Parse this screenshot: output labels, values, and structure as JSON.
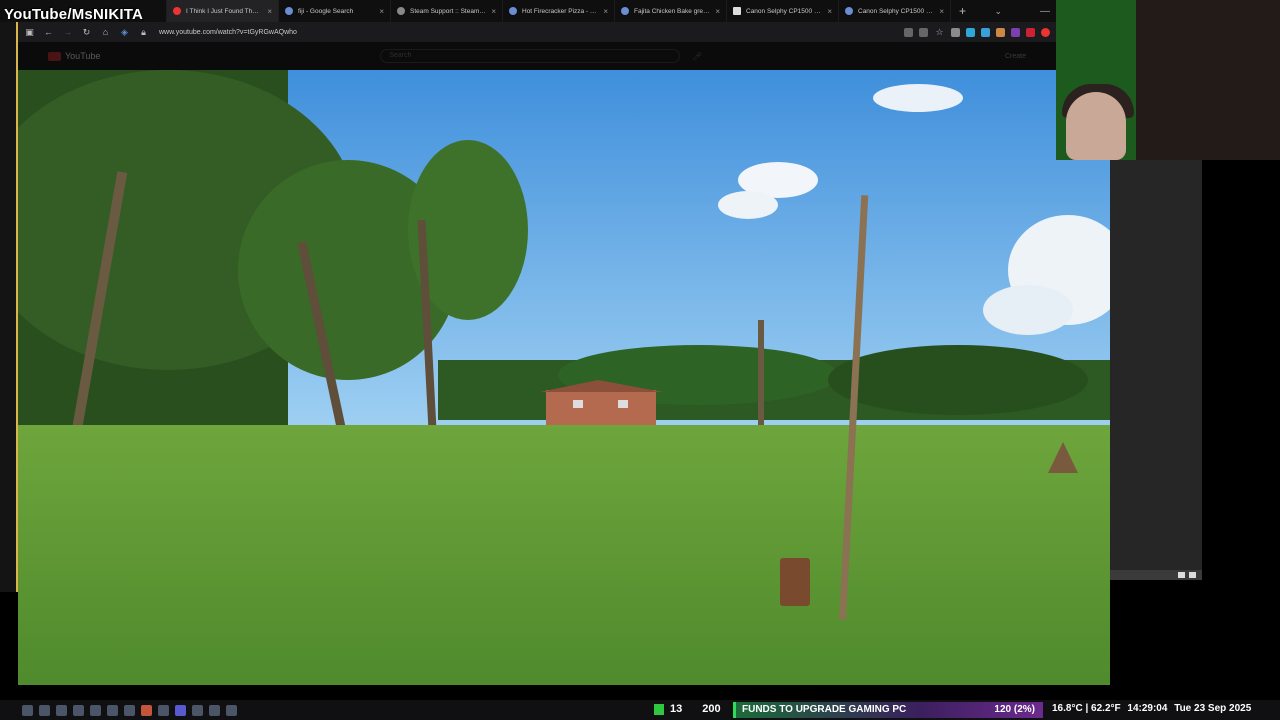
{
  "overlay": {
    "channel": "YouTube/MsNIKITA"
  },
  "tabs": [
    {
      "title": "I Think I Just Found The Be",
      "active": true
    },
    {
      "title": "fiji - Google Search"
    },
    {
      "title": "Steam Support :: SteamOS Insta"
    },
    {
      "title": "Hot Firecracker Pizza - Google"
    },
    {
      "title": "Fajita Chicken Bake greggs - G"
    },
    {
      "title": "Canon Selphy CP1500 - buy at"
    },
    {
      "title": "Canon Selphy CP1500 - Google"
    }
  ],
  "toolbar": {
    "url": "www.youtube.com/watch?v=tGyRGwAQwho"
  },
  "youtube": {
    "logo_text": "YouTube",
    "search_placeholder": "Search",
    "create_label": "Create"
  },
  "stream_stats": {
    "count": "13",
    "total": "200"
  },
  "goal": {
    "label": "FUNDS TO UPGRADE GAMING PC",
    "progress": "120 (2%)"
  },
  "system": {
    "temperature": "16.8°C | 62.2°F",
    "time": "14:29:04",
    "date": "Tue 23 Sep 2025"
  },
  "colors": {
    "accent_green": "#2fc640",
    "sky": "#4a9be0",
    "grass": "#5a9a34"
  }
}
